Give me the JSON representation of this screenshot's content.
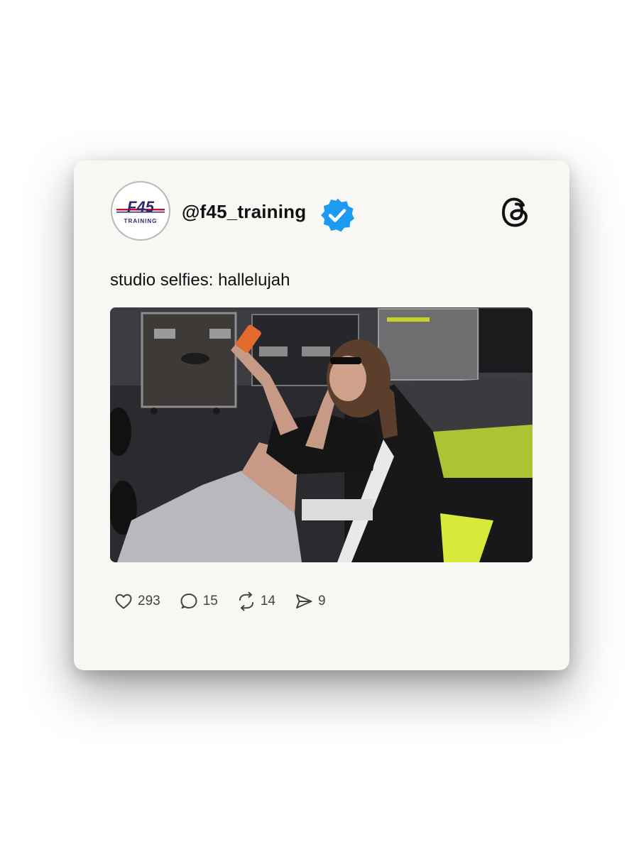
{
  "post": {
    "handle": "@f45_training",
    "verified": true,
    "text": "studio selfies: hallelujah",
    "image_description": "",
    "platform_icon": "threads-icon"
  },
  "avatar": {
    "logo_mark": "F45",
    "logo_word": "TRAINING",
    "brand_color": "#2c2a6b",
    "accent_color": "#c8102e"
  },
  "stats": {
    "likes": "293",
    "replies": "15",
    "reposts": "14",
    "shares": "9"
  },
  "colors": {
    "card_background": "#f8f7f4",
    "verified_blue": "#1d9bf0",
    "text": "#111111",
    "muted": "#444444"
  }
}
